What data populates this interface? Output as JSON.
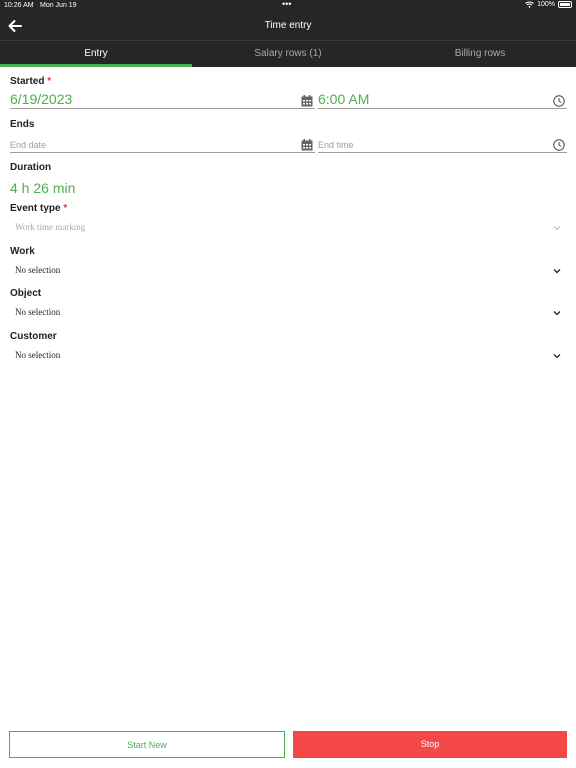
{
  "statusbar": {
    "time": "10:26 AM",
    "date": "Mon Jun 19",
    "dots": "•••",
    "battery": "100%"
  },
  "navbar": {
    "title": "Time entry",
    "back_icon": "arrow-left-icon"
  },
  "tabs": [
    {
      "label": "Entry",
      "active": true
    },
    {
      "label": "Salary rows (1)",
      "active": false
    },
    {
      "label": "Billing rows",
      "active": false
    }
  ],
  "form": {
    "started": {
      "label": "Started",
      "required_mark": "*",
      "date": "6/19/2023",
      "time": "6:00 AM"
    },
    "ends": {
      "label": "Ends",
      "date_placeholder": "End date",
      "time_placeholder": "End time"
    },
    "duration": {
      "label": "Duration",
      "value": "4 h 26 min"
    },
    "event_type": {
      "label": "Event type",
      "required_mark": "*",
      "value": "Work time marking"
    },
    "work": {
      "label": "Work",
      "value": "No selection"
    },
    "object": {
      "label": "Object",
      "value": "No selection"
    },
    "customer": {
      "label": "Customer",
      "value": "No selection"
    }
  },
  "actions": {
    "start_new": "Start New",
    "stop": "Stop"
  },
  "colors": {
    "accent": "#4caf50",
    "danger": "#f44747",
    "header": "#262626",
    "required": "#e53935"
  }
}
